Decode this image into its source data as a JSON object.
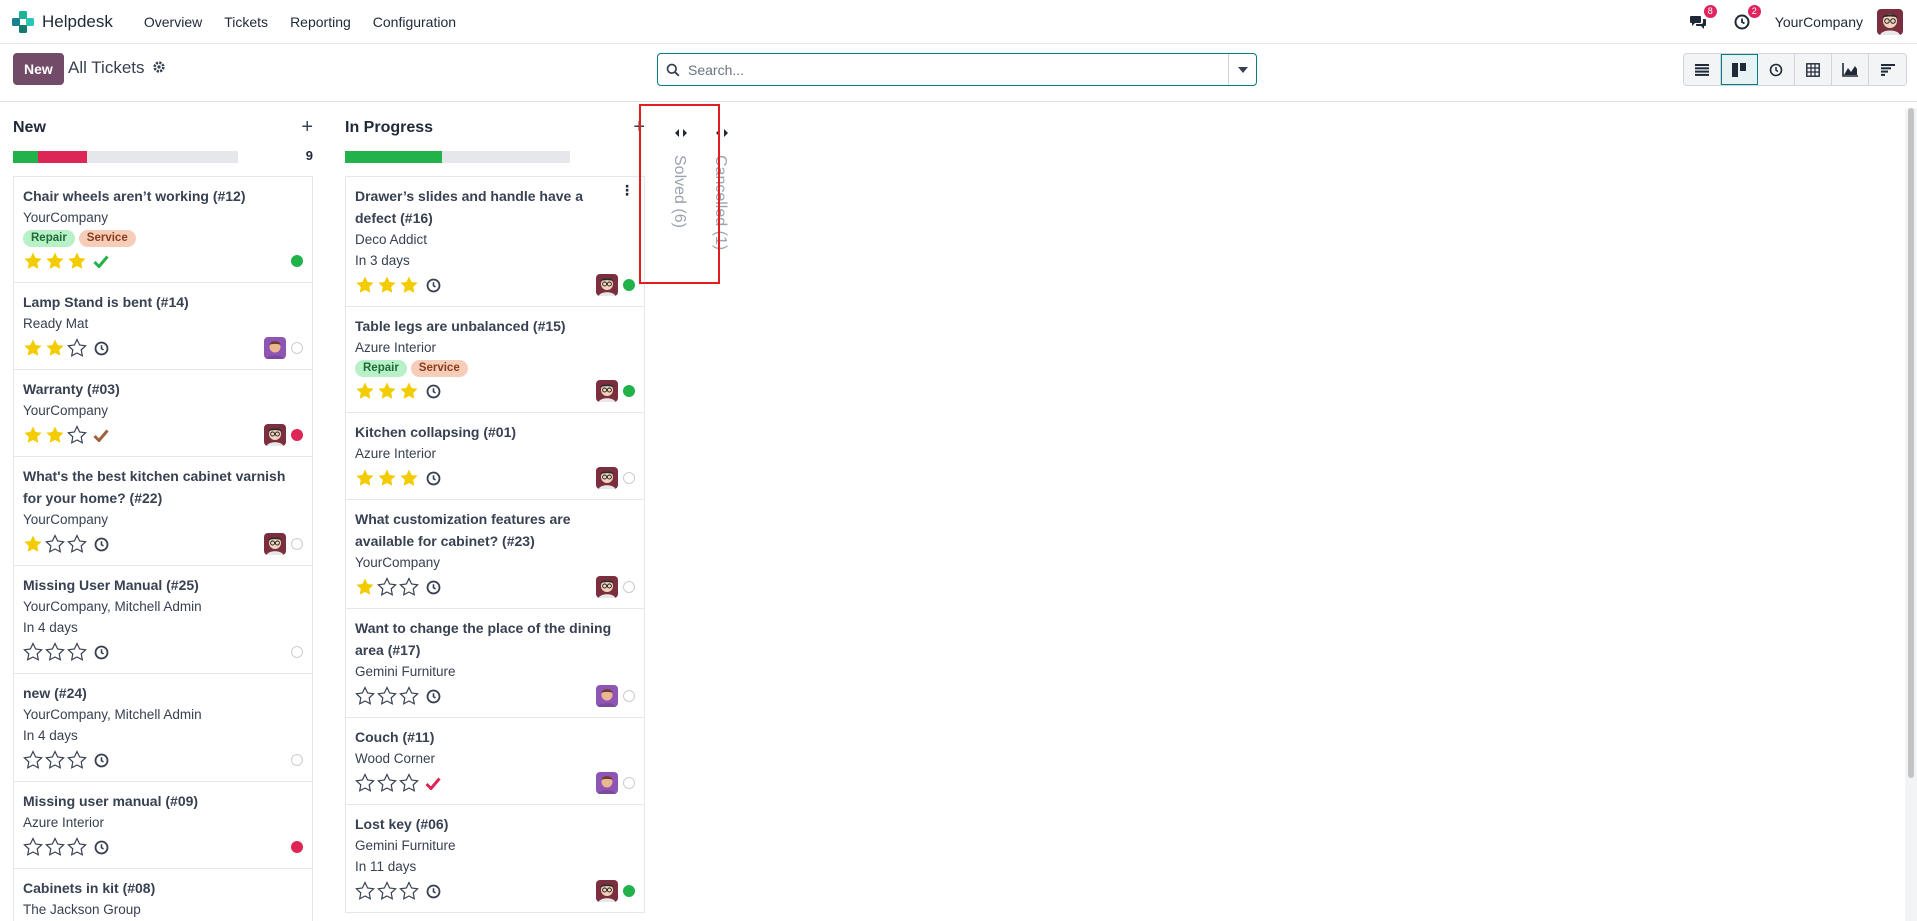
{
  "app": {
    "name": "Helpdesk",
    "menu": [
      "Overview",
      "Tickets",
      "Reporting",
      "Configuration"
    ],
    "discuss_count": "8",
    "activity_count": "2",
    "company": "YourCompany"
  },
  "control": {
    "new_label": "New",
    "breadcrumb": "All Tickets",
    "search_placeholder": "Search..."
  },
  "views": [
    "list-view-icon",
    "kanban-view-icon",
    "activity-view-icon",
    "pivot-view-icon",
    "graph-view-icon",
    "cohort-view-icon"
  ],
  "colors": {
    "brand": "#714b67",
    "accent": "#017e84",
    "green": "#21b24a",
    "red": "#dc2656",
    "star": "#f3cc00",
    "tag_repair_bg": "#b8f0c8",
    "tag_service_bg": "#f6cdb9"
  },
  "columns": [
    {
      "title": "New",
      "count": "9",
      "progress": {
        "green": 0.11,
        "red": 0.22
      },
      "cards": [
        {
          "title": "Chair wheels aren’t working (#12)",
          "lines": [
            "YourCompany"
          ],
          "tags": [
            "Repair",
            "Service"
          ],
          "stars": 3,
          "activity": "check-green",
          "avatar": false,
          "state": "green"
        },
        {
          "title": "Lamp Stand is bent (#14)",
          "lines": [
            "Ready Mat"
          ],
          "tags": [],
          "stars": 2,
          "activity": "clock",
          "avatar": "purple",
          "state": "grey"
        },
        {
          "title": "Warranty (#03)",
          "lines": [
            "YourCompany"
          ],
          "tags": [],
          "stars": 2,
          "activity": "check-brown",
          "avatar": "dark",
          "state": "red"
        },
        {
          "title": "What's the best kitchen cabinet varnish for your home? (#22)",
          "lines": [
            "YourCompany"
          ],
          "tags": [],
          "stars": 1,
          "activity": "clock",
          "avatar": "dark",
          "state": "grey"
        },
        {
          "title": "Missing User Manual (#25)",
          "lines": [
            "YourCompany, Mitchell Admin",
            "In 4 days"
          ],
          "tags": [],
          "stars": 0,
          "activity": "clock",
          "avatar": false,
          "state": "grey"
        },
        {
          "title": "new (#24)",
          "lines": [
            "YourCompany, Mitchell Admin",
            "In 4 days"
          ],
          "tags": [],
          "stars": 0,
          "activity": "clock",
          "avatar": false,
          "state": "grey"
        },
        {
          "title": "Missing user manual (#09)",
          "lines": [
            "Azure Interior"
          ],
          "tags": [],
          "stars": 0,
          "activity": "clock",
          "avatar": false,
          "state": "red"
        },
        {
          "title": "Cabinets in kit (#08)",
          "lines": [
            "The Jackson Group"
          ],
          "tags": [],
          "stars": 0,
          "activity": "clock",
          "avatar": false,
          "state": "grey"
        }
      ]
    },
    {
      "title": "In Progress",
      "count": "",
      "progress": {
        "green": 0.43,
        "red": 0
      },
      "cards": [
        {
          "title": "Drawer’s slides and handle have a defect (#16)",
          "lines": [
            "Deco Addict",
            "In 3 days"
          ],
          "tags": [],
          "stars": 3,
          "activity": "clock",
          "avatar": "dark",
          "state": "green",
          "kebab": true
        },
        {
          "title": "Table legs are unbalanced (#15)",
          "lines": [
            "Azure Interior"
          ],
          "tags": [
            "Repair",
            "Service"
          ],
          "stars": 3,
          "activity": "clock",
          "avatar": "dark",
          "state": "green"
        },
        {
          "title": "Kitchen collapsing (#01)",
          "lines": [
            "Azure Interior"
          ],
          "tags": [],
          "stars": 3,
          "activity": "clock",
          "avatar": "dark",
          "state": "grey"
        },
        {
          "title": "What customization features are available for cabinet? (#23)",
          "lines": [
            "YourCompany"
          ],
          "tags": [],
          "stars": 1,
          "activity": "clock",
          "avatar": "dark",
          "state": "grey"
        },
        {
          "title": "Want to change the place of the dining area (#17)",
          "lines": [
            "Gemini Furniture"
          ],
          "tags": [],
          "stars": 0,
          "activity": "clock",
          "avatar": "purple",
          "state": "grey"
        },
        {
          "title": "Couch (#11)",
          "lines": [
            "Wood Corner"
          ],
          "tags": [],
          "stars": 0,
          "activity": "check-red",
          "avatar": "purple",
          "state": "grey"
        },
        {
          "title": "Lost key (#06)",
          "lines": [
            "Gemini Furniture",
            "In 11 days"
          ],
          "tags": [],
          "stars": 0,
          "activity": "clock",
          "avatar": "dark",
          "state": "green"
        }
      ]
    }
  ],
  "folded_columns": [
    {
      "label": "Solved (6)"
    },
    {
      "label": "Cancelled (1)"
    }
  ]
}
